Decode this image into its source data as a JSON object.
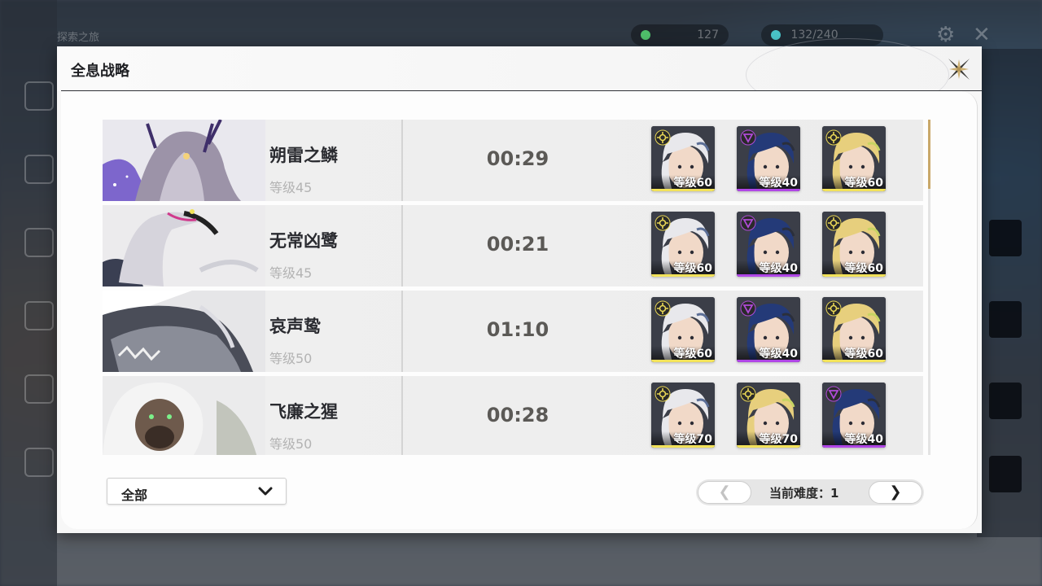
{
  "background": {
    "top_left_text": "探索之旅",
    "resources": [
      {
        "name": "resource-1",
        "value": "127",
        "color": "#4fbf6a"
      },
      {
        "name": "resource-2",
        "value": "132/240",
        "color": "#4ac3c8"
      }
    ]
  },
  "panel": {
    "title": "全息战略"
  },
  "bosses": [
    {
      "name": "朔雷之鳞",
      "level": "等级45",
      "time": "00:29",
      "team": [
        {
          "level": "等级60",
          "rarity": "gold",
          "element": "spectro",
          "hair": "#e8e8ec",
          "accent": "#5b6e96"
        },
        {
          "level": "等级40",
          "rarity": "purple",
          "element": "havoc",
          "hair": "#243a78",
          "accent": "#2b2f3b"
        },
        {
          "level": "等级60",
          "rarity": "gold",
          "element": "spectro",
          "hair": "#e7cf7d",
          "accent": "#c7d463"
        }
      ]
    },
    {
      "name": "无常凶鹭",
      "level": "等级45",
      "time": "00:21",
      "team": [
        {
          "level": "等级60",
          "rarity": "gold",
          "element": "spectro",
          "hair": "#e8e8ec",
          "accent": "#5b6e96"
        },
        {
          "level": "等级40",
          "rarity": "purple",
          "element": "havoc",
          "hair": "#243a78",
          "accent": "#2b2f3b"
        },
        {
          "level": "等级60",
          "rarity": "gold",
          "element": "spectro",
          "hair": "#e7cf7d",
          "accent": "#c7d463"
        }
      ]
    },
    {
      "name": "哀声鸷",
      "level": "等级50",
      "time": "01:10",
      "team": [
        {
          "level": "等级60",
          "rarity": "gold",
          "element": "spectro",
          "hair": "#e8e8ec",
          "accent": "#5b6e96"
        },
        {
          "level": "等级40",
          "rarity": "purple",
          "element": "havoc",
          "hair": "#243a78",
          "accent": "#2b2f3b"
        },
        {
          "level": "等级60",
          "rarity": "gold",
          "element": "spectro",
          "hair": "#e7cf7d",
          "accent": "#c7d463"
        }
      ]
    },
    {
      "name": "飞廉之猩",
      "level": "等级50",
      "time": "00:28",
      "team": [
        {
          "level": "等级70",
          "rarity": "gold",
          "element": "spectro",
          "hair": "#e8e8ec",
          "accent": "#5b6e96"
        },
        {
          "level": "等级70",
          "rarity": "gold",
          "element": "spectro",
          "hair": "#e7cf7d",
          "accent": "#c7d463"
        },
        {
          "level": "等级40",
          "rarity": "purple",
          "element": "havoc",
          "hair": "#243a78",
          "accent": "#2b2f3b"
        }
      ]
    }
  ],
  "filter": {
    "selected": "全部"
  },
  "pager": {
    "label": "当前难度：1",
    "prev_symbol": "❮",
    "next_symbol": "❯"
  },
  "colors": {
    "rarity_gold": "#f2e25a",
    "rarity_purple": "#b046e6",
    "spectro": "#e8d655",
    "havoc": "#b04ad8"
  }
}
